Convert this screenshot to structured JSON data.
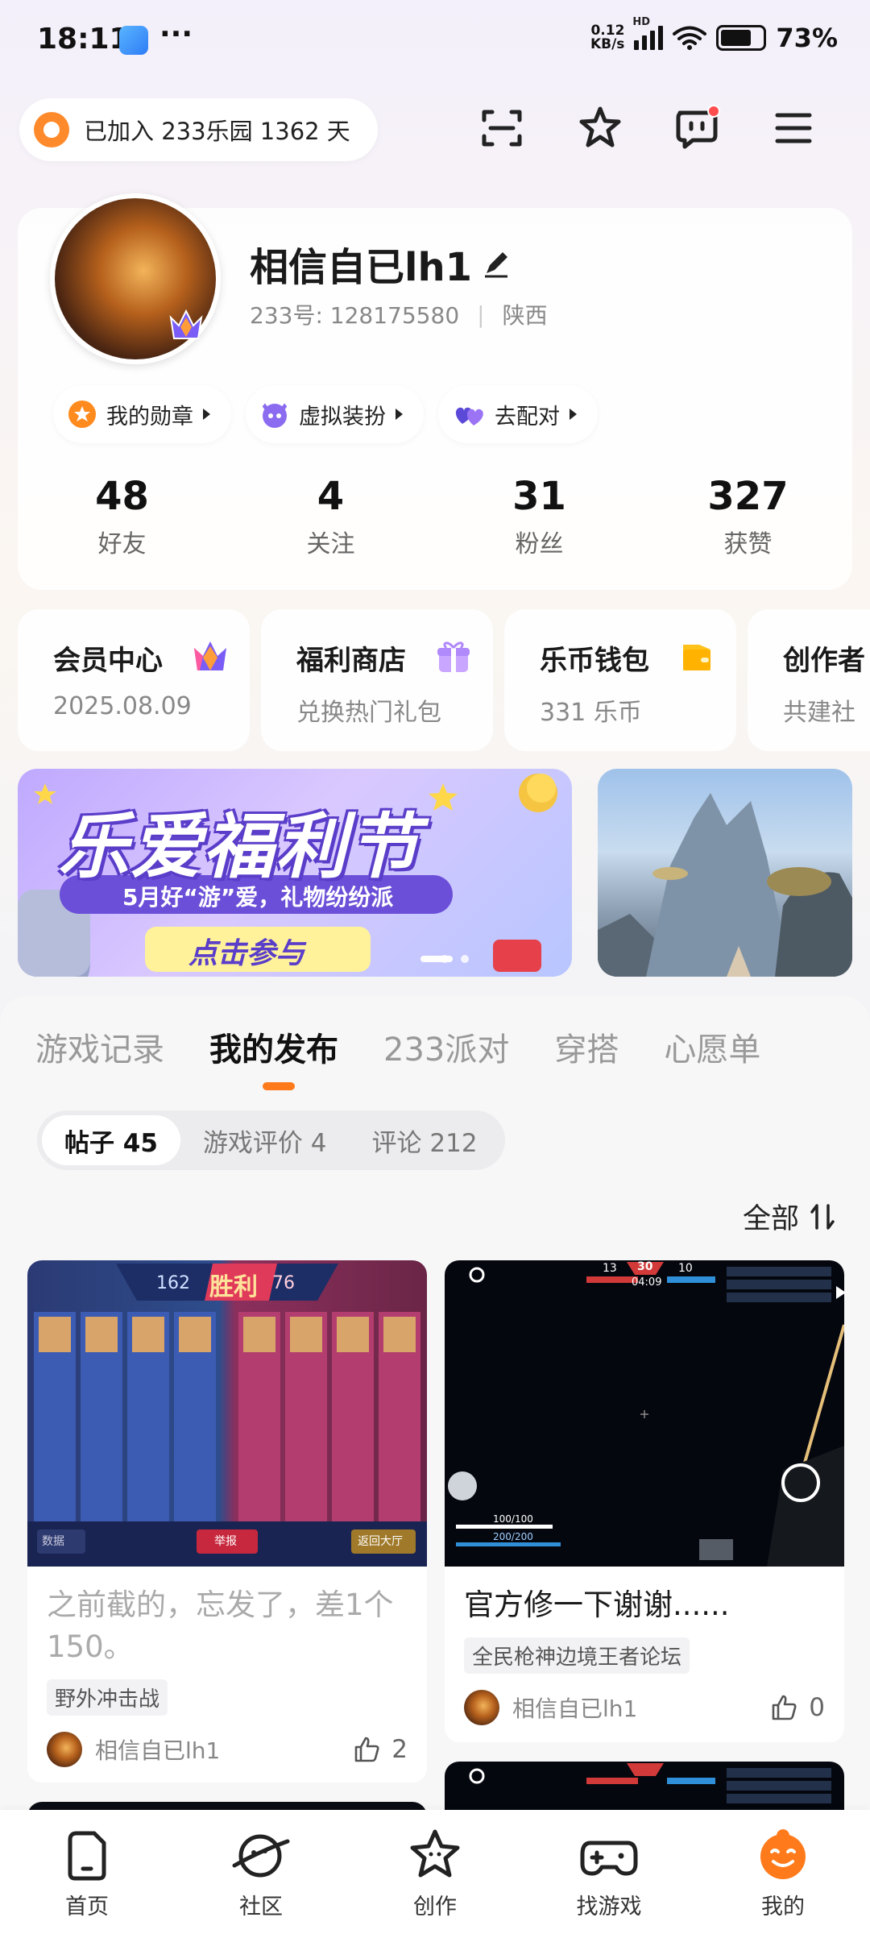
{
  "status_bar": {
    "time": "18:11",
    "more": "···",
    "net_speed_value": "0.12",
    "net_speed_unit": "KB/s",
    "network_type": "HD",
    "battery_percent": "73%",
    "battery_level": 0.73
  },
  "header": {
    "join_text": "已加入 233乐园 1362 天",
    "icons": [
      "scan-icon",
      "badge-star-icon",
      "message-icon",
      "menu-icon"
    ]
  },
  "profile": {
    "username": "相信自已lh1",
    "id_label": "233号:",
    "id_value": "128175580",
    "region": "陕西",
    "chips": [
      {
        "label": "我的勋章",
        "icon": "medal-icon",
        "color": "#ff8a1e"
      },
      {
        "label": "虚拟装扮",
        "icon": "mask-icon",
        "color": "#8b6cf0"
      },
      {
        "label": "去配对",
        "icon": "hearts-icon",
        "color": "#7a4dea"
      }
    ],
    "stats": [
      {
        "value": "48",
        "label": "好友"
      },
      {
        "value": "4",
        "label": "关注"
      },
      {
        "value": "31",
        "label": "粉丝"
      },
      {
        "value": "327",
        "label": "获赞"
      }
    ]
  },
  "quick_cards": [
    {
      "title": "会员中心",
      "sub": "2025.08.09",
      "icon": "crown-icon"
    },
    {
      "title": "福利商店",
      "sub": "兑换热门礼包",
      "icon": "gift-icon"
    },
    {
      "title": "乐币钱包",
      "sub": "331 乐币",
      "icon": "wallet-icon"
    },
    {
      "title": "创作者",
      "sub": "共建社",
      "icon": ""
    }
  ],
  "banner": {
    "headline": "乐爱福利节",
    "subline": "5月好“游”爱，礼物纷纷派",
    "cta": "点击参与"
  },
  "tabs": [
    {
      "label": "游戏记录",
      "active": false
    },
    {
      "label": "我的发布",
      "active": true
    },
    {
      "label": "233派对",
      "active": false
    },
    {
      "label": "穿搭",
      "active": false
    },
    {
      "label": "心愿单",
      "active": false
    }
  ],
  "subtabs": [
    {
      "label": "帖子 45",
      "active": true
    },
    {
      "label": "游戏评价 4",
      "active": false
    },
    {
      "label": "评论 212",
      "active": false
    }
  ],
  "sort_label": "全部",
  "posts": [
    {
      "title": "之前截的，忘发了，差1个150。",
      "tag": "野外冲击战",
      "author": "相信自已lh1",
      "likes": "2",
      "image": {
        "score_left": "162",
        "result": "胜利",
        "score_right": "76",
        "btn_left": "数据",
        "btn_mid": "举报",
        "btn_right": "返回大厅"
      }
    },
    {
      "title": "官方修一下谢谢......",
      "tag": "全民枪神边境王者论坛",
      "author": "相信自已lh1",
      "likes": "0",
      "image": {
        "score_left": "13",
        "score_mid": "30",
        "score_right": "10",
        "timer": "04:09",
        "hp": "100/100",
        "armor": "200/200"
      }
    }
  ],
  "bottom_nav": [
    {
      "label": "首页",
      "icon": "home-icon",
      "active": false
    },
    {
      "label": "社区",
      "icon": "community-icon",
      "active": false
    },
    {
      "label": "创作",
      "icon": "create-icon",
      "active": false
    },
    {
      "label": "找游戏",
      "icon": "gamepad-icon",
      "active": false
    },
    {
      "label": "我的",
      "icon": "profile-icon",
      "active": true
    }
  ],
  "colors": {
    "accent": "#ff7a1a",
    "text": "#1a1a1a",
    "muted": "#888888"
  }
}
